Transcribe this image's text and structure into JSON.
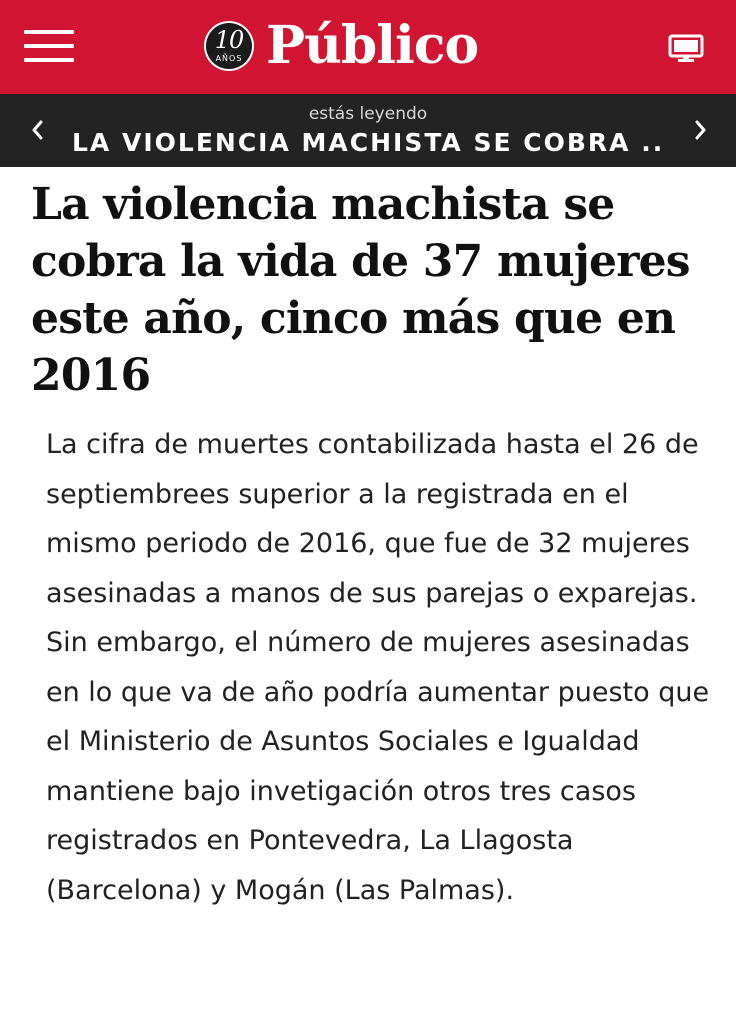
{
  "colors": {
    "brand_red": "#d11432",
    "reading_bar": "#232323",
    "text": "#111111"
  },
  "header": {
    "menu_icon": "hamburger-menu-icon",
    "logo": {
      "badge_number": "10",
      "badge_years": "AÑOS",
      "brand_name": "Público"
    },
    "desktop_icon": "desktop-monitor-icon"
  },
  "reading_bar": {
    "label": "estás leyendo",
    "title": "LA VIOLENCIA MACHISTA SE COBRA ...",
    "prev_icon": "chevron-left-icon",
    "next_icon": "chevron-right-icon"
  },
  "article": {
    "headline": "La violencia machista se cobra la vida de 37 mujeres este año, cinco más que en 2016",
    "summary": "La cifra de muertes contabilizada hasta el 26 de septiembrees superior a la registrada en el mismo periodo de 2016, que fue de 32 mujeres asesinadas a manos de sus parejas o exparejas. Sin embargo, el número de mujeres asesinadas en lo que va de año podría aumentar puesto que el Ministerio de Asuntos Sociales e Igualdad mantiene bajo invetigación otros tres casos registrados en Pontevedra, La Llagosta (Barcelona) y Mogán (Las Palmas)."
  }
}
